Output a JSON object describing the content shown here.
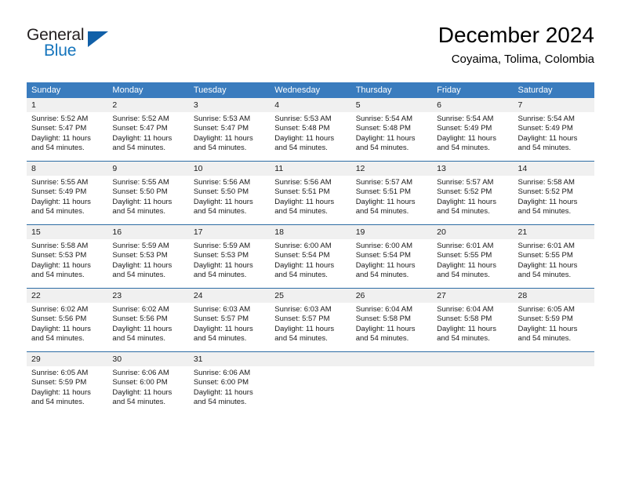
{
  "brand": {
    "name_top": "General",
    "name_bottom": "Blue",
    "triangle_color": "#1160a8",
    "blue_color": "#1474bc"
  },
  "header": {
    "title": "December 2024",
    "subtitle": "Coyaima, Tolima, Colombia"
  },
  "theme": {
    "header_bg": "#3a7cbe",
    "row_divider": "#2e6da4",
    "daynum_bg": "#f0f0f0"
  },
  "weekday_headers": [
    "Sunday",
    "Monday",
    "Tuesday",
    "Wednesday",
    "Thursday",
    "Friday",
    "Saturday"
  ],
  "weeks": [
    [
      {
        "day": "1",
        "sunrise": "Sunrise: 5:52 AM",
        "sunset": "Sunset: 5:47 PM",
        "daylight": "Daylight: 11 hours and 54 minutes."
      },
      {
        "day": "2",
        "sunrise": "Sunrise: 5:52 AM",
        "sunset": "Sunset: 5:47 PM",
        "daylight": "Daylight: 11 hours and 54 minutes."
      },
      {
        "day": "3",
        "sunrise": "Sunrise: 5:53 AM",
        "sunset": "Sunset: 5:47 PM",
        "daylight": "Daylight: 11 hours and 54 minutes."
      },
      {
        "day": "4",
        "sunrise": "Sunrise: 5:53 AM",
        "sunset": "Sunset: 5:48 PM",
        "daylight": "Daylight: 11 hours and 54 minutes."
      },
      {
        "day": "5",
        "sunrise": "Sunrise: 5:54 AM",
        "sunset": "Sunset: 5:48 PM",
        "daylight": "Daylight: 11 hours and 54 minutes."
      },
      {
        "day": "6",
        "sunrise": "Sunrise: 5:54 AM",
        "sunset": "Sunset: 5:49 PM",
        "daylight": "Daylight: 11 hours and 54 minutes."
      },
      {
        "day": "7",
        "sunrise": "Sunrise: 5:54 AM",
        "sunset": "Sunset: 5:49 PM",
        "daylight": "Daylight: 11 hours and 54 minutes."
      }
    ],
    [
      {
        "day": "8",
        "sunrise": "Sunrise: 5:55 AM",
        "sunset": "Sunset: 5:49 PM",
        "daylight": "Daylight: 11 hours and 54 minutes."
      },
      {
        "day": "9",
        "sunrise": "Sunrise: 5:55 AM",
        "sunset": "Sunset: 5:50 PM",
        "daylight": "Daylight: 11 hours and 54 minutes."
      },
      {
        "day": "10",
        "sunrise": "Sunrise: 5:56 AM",
        "sunset": "Sunset: 5:50 PM",
        "daylight": "Daylight: 11 hours and 54 minutes."
      },
      {
        "day": "11",
        "sunrise": "Sunrise: 5:56 AM",
        "sunset": "Sunset: 5:51 PM",
        "daylight": "Daylight: 11 hours and 54 minutes."
      },
      {
        "day": "12",
        "sunrise": "Sunrise: 5:57 AM",
        "sunset": "Sunset: 5:51 PM",
        "daylight": "Daylight: 11 hours and 54 minutes."
      },
      {
        "day": "13",
        "sunrise": "Sunrise: 5:57 AM",
        "sunset": "Sunset: 5:52 PM",
        "daylight": "Daylight: 11 hours and 54 minutes."
      },
      {
        "day": "14",
        "sunrise": "Sunrise: 5:58 AM",
        "sunset": "Sunset: 5:52 PM",
        "daylight": "Daylight: 11 hours and 54 minutes."
      }
    ],
    [
      {
        "day": "15",
        "sunrise": "Sunrise: 5:58 AM",
        "sunset": "Sunset: 5:53 PM",
        "daylight": "Daylight: 11 hours and 54 minutes."
      },
      {
        "day": "16",
        "sunrise": "Sunrise: 5:59 AM",
        "sunset": "Sunset: 5:53 PM",
        "daylight": "Daylight: 11 hours and 54 minutes."
      },
      {
        "day": "17",
        "sunrise": "Sunrise: 5:59 AM",
        "sunset": "Sunset: 5:53 PM",
        "daylight": "Daylight: 11 hours and 54 minutes."
      },
      {
        "day": "18",
        "sunrise": "Sunrise: 6:00 AM",
        "sunset": "Sunset: 5:54 PM",
        "daylight": "Daylight: 11 hours and 54 minutes."
      },
      {
        "day": "19",
        "sunrise": "Sunrise: 6:00 AM",
        "sunset": "Sunset: 5:54 PM",
        "daylight": "Daylight: 11 hours and 54 minutes."
      },
      {
        "day": "20",
        "sunrise": "Sunrise: 6:01 AM",
        "sunset": "Sunset: 5:55 PM",
        "daylight": "Daylight: 11 hours and 54 minutes."
      },
      {
        "day": "21",
        "sunrise": "Sunrise: 6:01 AM",
        "sunset": "Sunset: 5:55 PM",
        "daylight": "Daylight: 11 hours and 54 minutes."
      }
    ],
    [
      {
        "day": "22",
        "sunrise": "Sunrise: 6:02 AM",
        "sunset": "Sunset: 5:56 PM",
        "daylight": "Daylight: 11 hours and 54 minutes."
      },
      {
        "day": "23",
        "sunrise": "Sunrise: 6:02 AM",
        "sunset": "Sunset: 5:56 PM",
        "daylight": "Daylight: 11 hours and 54 minutes."
      },
      {
        "day": "24",
        "sunrise": "Sunrise: 6:03 AM",
        "sunset": "Sunset: 5:57 PM",
        "daylight": "Daylight: 11 hours and 54 minutes."
      },
      {
        "day": "25",
        "sunrise": "Sunrise: 6:03 AM",
        "sunset": "Sunset: 5:57 PM",
        "daylight": "Daylight: 11 hours and 54 minutes."
      },
      {
        "day": "26",
        "sunrise": "Sunrise: 6:04 AM",
        "sunset": "Sunset: 5:58 PM",
        "daylight": "Daylight: 11 hours and 54 minutes."
      },
      {
        "day": "27",
        "sunrise": "Sunrise: 6:04 AM",
        "sunset": "Sunset: 5:58 PM",
        "daylight": "Daylight: 11 hours and 54 minutes."
      },
      {
        "day": "28",
        "sunrise": "Sunrise: 6:05 AM",
        "sunset": "Sunset: 5:59 PM",
        "daylight": "Daylight: 11 hours and 54 minutes."
      }
    ],
    [
      {
        "day": "29",
        "sunrise": "Sunrise: 6:05 AM",
        "sunset": "Sunset: 5:59 PM",
        "daylight": "Daylight: 11 hours and 54 minutes."
      },
      {
        "day": "30",
        "sunrise": "Sunrise: 6:06 AM",
        "sunset": "Sunset: 6:00 PM",
        "daylight": "Daylight: 11 hours and 54 minutes."
      },
      {
        "day": "31",
        "sunrise": "Sunrise: 6:06 AM",
        "sunset": "Sunset: 6:00 PM",
        "daylight": "Daylight: 11 hours and 54 minutes."
      },
      {
        "day": "",
        "sunrise": "",
        "sunset": "",
        "daylight": ""
      },
      {
        "day": "",
        "sunrise": "",
        "sunset": "",
        "daylight": ""
      },
      {
        "day": "",
        "sunrise": "",
        "sunset": "",
        "daylight": ""
      },
      {
        "day": "",
        "sunrise": "",
        "sunset": "",
        "daylight": ""
      }
    ]
  ]
}
